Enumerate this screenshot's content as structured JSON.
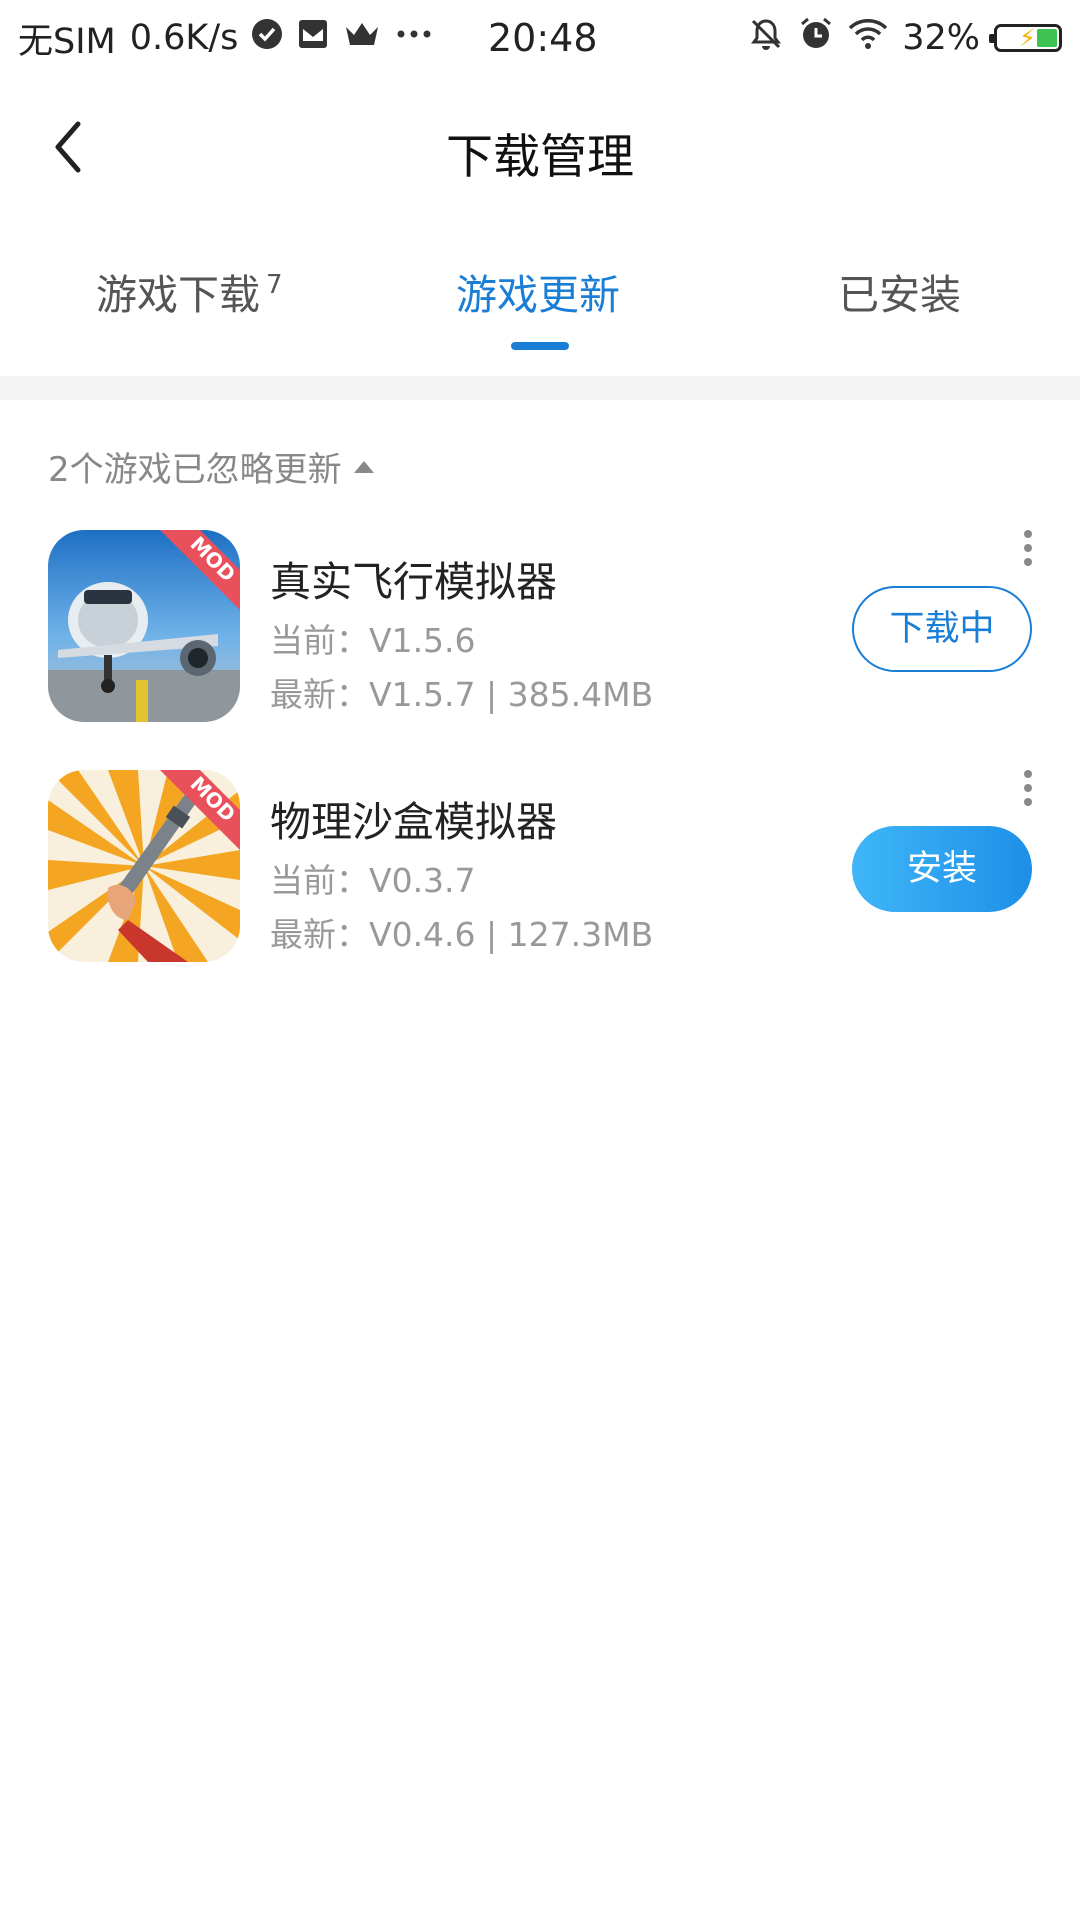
{
  "status_bar": {
    "carrier": "无SIM",
    "net_speed": "0.6K/s",
    "time": "20:48",
    "battery": "32%",
    "icons": [
      "check-circle-icon",
      "mail-icon",
      "crown-icon",
      "more-dots-icon",
      "bell-off-icon",
      "alarm-icon",
      "wifi-icon",
      "battery-icon"
    ]
  },
  "header": {
    "title": "下载管理",
    "back_icon": "chevron-left-icon"
  },
  "tabs": [
    {
      "label": "游戏下载",
      "count": "7",
      "active": false
    },
    {
      "label": "游戏更新",
      "active": true
    },
    {
      "label": "已安装",
      "active": false
    }
  ],
  "ignored_notice": "2个游戏已忽略更新",
  "games": [
    {
      "name": "真实飞行模拟器",
      "current": "当前：V1.5.6",
      "latest": "最新：V1.5.7 | 385.4MB",
      "action": "下载中",
      "badge": "MOD"
    },
    {
      "name": "物理沙盒模拟器",
      "current": "当前：V0.3.7",
      "latest": "最新：V0.4.6 | 127.3MB",
      "action": "安装",
      "badge": "MOD"
    }
  ],
  "colors": {
    "accent": "#1a7ed6",
    "button_gradient_start": "#3fb6f7",
    "button_gradient_end": "#1e8fe8",
    "mod_badge": "#e8505b"
  }
}
